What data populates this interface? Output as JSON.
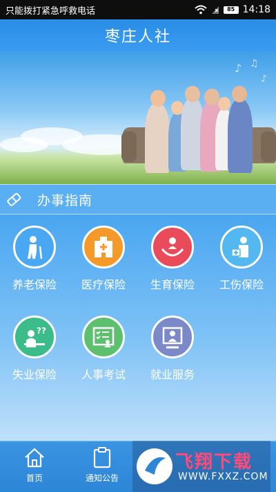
{
  "status_bar": {
    "carrier": "只能拨打紧急呼救电话",
    "battery": "85",
    "time": "14:18"
  },
  "header": {
    "title": "枣庄人社"
  },
  "section": {
    "title": "办事指南"
  },
  "services": [
    {
      "label": "养老保险",
      "icon": "elderly-icon",
      "color": "#4aa8f2"
    },
    {
      "label": "医疗保险",
      "icon": "hospital-icon",
      "color": "#f59a2a"
    },
    {
      "label": "生育保险",
      "icon": "maternity-icon",
      "color": "#ea4b5a"
    },
    {
      "label": "工伤保险",
      "icon": "injury-icon",
      "color": "#52b8ef"
    },
    {
      "label": "失业保险",
      "icon": "unemployment-icon",
      "color": "#3cbc8a"
    },
    {
      "label": "人事考试",
      "icon": "exam-icon",
      "color": "#5cc06e"
    },
    {
      "label": "就业服务",
      "icon": "employment-icon",
      "color": "#7c89c8"
    }
  ],
  "nav": [
    {
      "label": "首页",
      "icon": "home-icon"
    },
    {
      "label": "通知公告",
      "icon": "notice-icon"
    }
  ],
  "watermark": {
    "brand": "飞翔下载",
    "url": "WWW.FXXZ.COM"
  }
}
